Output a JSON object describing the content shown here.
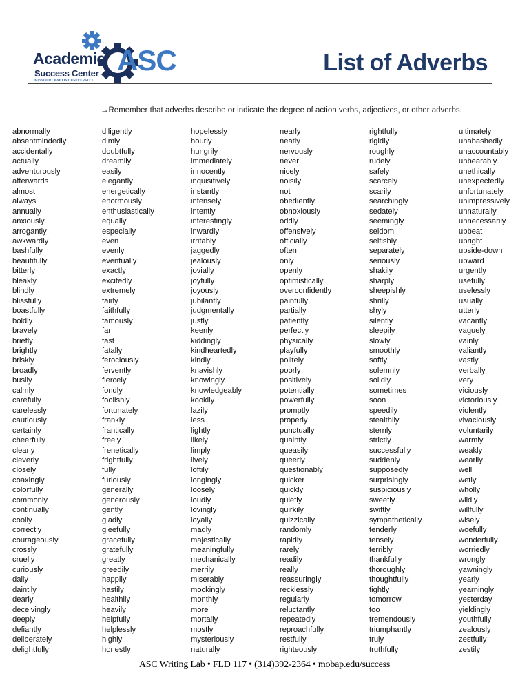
{
  "header": {
    "logo": {
      "line1": "Academic",
      "line2": "Success Center",
      "line3": "MISSOURI BAPTIST UNIVERSITY",
      "acronym": "ASC"
    },
    "title": "List of Adverbs"
  },
  "intro": "→Remember that adverbs describe or indicate the degree of action verbs, adjectives, or other adverbs.",
  "columns": [
    [
      "abnormally",
      "absentmindedly",
      "accidentally",
      "actually",
      "adventurously",
      "afterwards",
      "almost",
      "always",
      "annually",
      "anxiously",
      "arrogantly",
      "awkwardly",
      "bashfully",
      "beautifully",
      "bitterly",
      "bleakly",
      "blindly",
      "blissfully",
      "boastfully",
      "boldly",
      "bravely",
      "briefly",
      "brightly",
      "briskly",
      "broadly",
      "busily",
      "calmly",
      "carefully",
      "carelessly",
      "cautiously",
      "certainly",
      "cheerfully",
      "clearly",
      "cleverly",
      "closely",
      "coaxingly",
      "colorfully",
      "commonly",
      "continually",
      "coolly",
      "correctly",
      "courageously",
      "crossly",
      "cruelly",
      "curiously",
      "daily",
      "daintily",
      "dearly",
      "deceivingly",
      "deeply",
      "defiantly",
      "deliberately",
      "delightfully"
    ],
    [
      "diligently",
      "dimly",
      "doubtfully",
      "dreamily",
      "easily",
      "elegantly",
      "energetically",
      "enormously",
      "enthusiastically",
      "equally",
      "especially",
      "even",
      "evenly",
      "eventually",
      "exactly",
      "excitedly",
      "extremely",
      "fairly",
      "faithfully",
      "famously",
      "far",
      "fast",
      "fatally",
      "ferociously",
      "fervently",
      "fiercely",
      "fondly",
      "foolishly",
      "fortunately",
      "frankly",
      "frantically",
      "freely",
      "frenetically",
      "frightfully",
      "fully",
      "furiously",
      "generally",
      "generously",
      "gently",
      "gladly",
      "gleefully",
      "gracefully",
      "gratefully",
      "greatly",
      "greedily",
      "happily",
      "hastily",
      "healthily",
      "heavily",
      "helpfully",
      "helplessly",
      "highly",
      "honestly"
    ],
    [
      "hopelessly",
      "hourly",
      "hungrily",
      "immediately",
      "innocently",
      "inquisitively",
      "instantly",
      "intensely",
      "intently",
      "interestingly",
      "inwardly",
      "irritably",
      "jaggedly",
      "jealously",
      "jovially",
      "joyfully",
      "joyously",
      "jubilantly",
      "judgmentally",
      "justly",
      "keenly",
      "kiddingly",
      "kindheartedly",
      "kindly",
      "knavishly",
      "knowingly",
      "knowledgeably",
      "kookily",
      "lazily",
      "less",
      "lightly",
      "likely",
      "limply",
      "lively",
      "loftily",
      "longingly",
      "loosely",
      "loudly",
      "lovingly",
      "loyally",
      "madly",
      "majestically",
      "meaningfully",
      "mechanically",
      "merrily",
      "miserably",
      "mockingly",
      "monthly",
      "more",
      "mortally",
      "mostly",
      "mysteriously",
      "naturally"
    ],
    [
      "nearly",
      "neatly",
      "nervously",
      "never",
      "nicely",
      "noisily",
      "not",
      "obediently",
      "obnoxiously",
      "oddly",
      "offensively",
      "officially",
      "often",
      "only",
      "openly",
      "optimistically",
      "overconfidently",
      "painfully",
      "partially",
      "patiently",
      "perfectly",
      "physically",
      "playfully",
      "politely",
      "poorly",
      "positively",
      "potentially",
      "powerfully",
      "promptly",
      "properly",
      "punctually",
      "quaintly",
      "queasily",
      "queerly",
      "questionably",
      "quicker",
      "quickly",
      "quietly",
      "quirkily",
      "quizzically",
      "randomly",
      "rapidly",
      "rarely",
      "readily",
      "really",
      "reassuringly",
      "recklessly",
      "regularly",
      "reluctantly",
      "repeatedly",
      "reproachfully",
      "restfully",
      "righteously"
    ],
    [
      "rightfully",
      "rigidly",
      "roughly",
      "rudely",
      "safely",
      "scarcely",
      "scarily",
      "searchingly",
      "sedately",
      "seemingly",
      "seldom",
      "selfishly",
      "separately",
      "seriously",
      "shakily",
      "sharply",
      "sheepishly",
      "shrilly",
      "shyly",
      "silently",
      "sleepily",
      "slowly",
      "smoothly",
      "softly",
      "solemnly",
      "solidly",
      "sometimes",
      "soon",
      "speedily",
      "stealthily",
      "sternly",
      "strictly",
      "successfully",
      "suddenly",
      "supposedly",
      "surprisingly",
      "suspiciously",
      "sweetly",
      "swiftly",
      "sympathetically",
      "tenderly",
      "tensely",
      "terribly",
      "thankfully",
      "thoroughly",
      "thoughtfully",
      "tightly",
      "tomorrow",
      "too",
      "tremendously",
      "triumphantly",
      "truly",
      "truthfully"
    ],
    [
      "ultimately",
      "unabashedly",
      "unaccountably",
      "unbearably",
      "unethically",
      "unexpectedly",
      "unfortunately",
      "unimpressively",
      "unnaturally",
      "unnecessarily",
      "upbeat",
      "upright",
      "upside-down",
      "upward",
      "urgently",
      "usefully",
      "uselessly",
      "usually",
      "utterly",
      "vacantly",
      "vaguely",
      "vainly",
      "valiantly",
      "vastly",
      "verbally",
      "very",
      "viciously",
      "victoriously",
      "violently",
      "vivaciously",
      "voluntarily",
      "warmly",
      "weakly",
      "wearily",
      "well",
      "wetly",
      "wholly",
      "wildly",
      "willfully",
      "wisely",
      "woefully",
      "wonderfully",
      "worriedly",
      "wrongly",
      "yawningly",
      "yearly",
      "yearningly",
      "yesterday",
      "yieldingly",
      "youthfully",
      "zealously",
      "zestfully",
      "zestily"
    ]
  ],
  "footer": "ASC Writing Lab • FLD 117 •  (314)392-2364 •  mobap.edu/success"
}
